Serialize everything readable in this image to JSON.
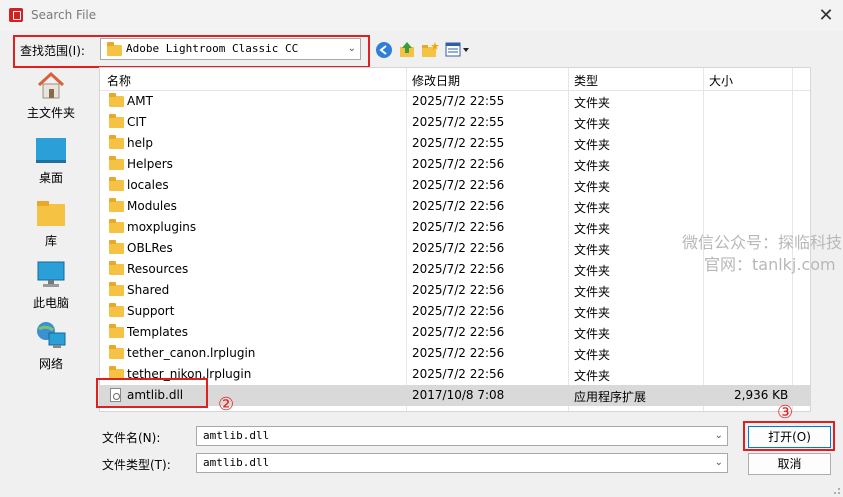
{
  "window": {
    "title": "Search File",
    "close_glyph": "✕"
  },
  "lookin": {
    "label": "查找范围(I):",
    "value": "Adobe Lightroom Classic CC"
  },
  "annotations": {
    "one": "①",
    "two": "②",
    "three": "③"
  },
  "places": [
    {
      "label": "主文件夹",
      "icon": "home-icon"
    },
    {
      "label": "桌面",
      "icon": "desktop-icon"
    },
    {
      "label": "库",
      "icon": "library-icon"
    },
    {
      "label": "此电脑",
      "icon": "computer-icon"
    },
    {
      "label": "网络",
      "icon": "network-icon"
    }
  ],
  "columns": {
    "name": "名称",
    "modified": "修改日期",
    "type": "类型",
    "size": "大小"
  },
  "files": [
    {
      "name": "AMT",
      "date": "2025/7/2 22:55",
      "type": "文件夹",
      "size": ""
    },
    {
      "name": "CIT",
      "date": "2025/7/2 22:55",
      "type": "文件夹",
      "size": ""
    },
    {
      "name": "help",
      "date": "2025/7/2 22:55",
      "type": "文件夹",
      "size": ""
    },
    {
      "name": "Helpers",
      "date": "2025/7/2 22:56",
      "type": "文件夹",
      "size": ""
    },
    {
      "name": "locales",
      "date": "2025/7/2 22:56",
      "type": "文件夹",
      "size": ""
    },
    {
      "name": "Modules",
      "date": "2025/7/2 22:56",
      "type": "文件夹",
      "size": ""
    },
    {
      "name": "moxplugins",
      "date": "2025/7/2 22:56",
      "type": "文件夹",
      "size": ""
    },
    {
      "name": "OBLRes",
      "date": "2025/7/2 22:56",
      "type": "文件夹",
      "size": ""
    },
    {
      "name": "Resources",
      "date": "2025/7/2 22:56",
      "type": "文件夹",
      "size": ""
    },
    {
      "name": "Shared",
      "date": "2025/7/2 22:56",
      "type": "文件夹",
      "size": ""
    },
    {
      "name": "Support",
      "date": "2025/7/2 22:56",
      "type": "文件夹",
      "size": ""
    },
    {
      "name": "Templates",
      "date": "2025/7/2 22:56",
      "type": "文件夹",
      "size": ""
    },
    {
      "name": "tether_canon.lrplugin",
      "date": "2025/7/2 22:56",
      "type": "文件夹",
      "size": ""
    },
    {
      "name": "tether_nikon.lrplugin",
      "date": "2025/7/2 22:56",
      "type": "文件夹",
      "size": ""
    },
    {
      "name": "amtlib.dll",
      "date": "2017/10/8 7:08",
      "type": "应用程序扩展",
      "size": "2,936 KB"
    }
  ],
  "filename": {
    "label": "文件名(N):",
    "value": "amtlib.dll"
  },
  "filetype": {
    "label": "文件类型(T):",
    "value": "amtlib.dll"
  },
  "buttons": {
    "open": "打开(O)",
    "cancel": "取消"
  },
  "watermark": {
    "line1": "微信公众号：探临科技",
    "line2": "官网：tanlkj.com"
  }
}
